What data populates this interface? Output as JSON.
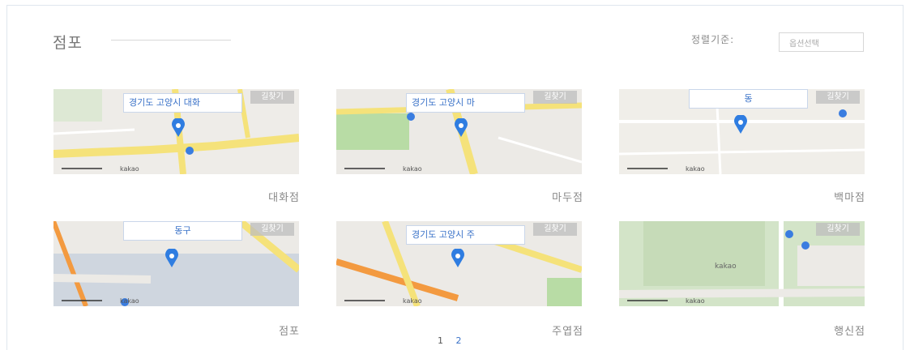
{
  "section": {
    "title": "점포",
    "sort_label": "정렬기준:",
    "sort_value": "옵션선택"
  },
  "map": {
    "route_label": "길찾기",
    "kakao_label": "kakao"
  },
  "stores": [
    {
      "name": "대화점",
      "address": "경기도 고양시 대화"
    },
    {
      "name": "마두점",
      "address": "경기도 고양시 마"
    },
    {
      "name": "백마점",
      "address": "동"
    },
    {
      "name": "점포",
      "address": "동구"
    },
    {
      "name": "주엽점",
      "address": "경기도 고양시 주"
    },
    {
      "name": "행신점",
      "address": ""
    }
  ],
  "pagination": {
    "pages": [
      "1",
      "2"
    ],
    "current": "1"
  },
  "colors": {
    "marker": "#2f7de1",
    "road": "#f5e27a",
    "green": "#b8dca5",
    "address_text": "#3a72c8"
  }
}
